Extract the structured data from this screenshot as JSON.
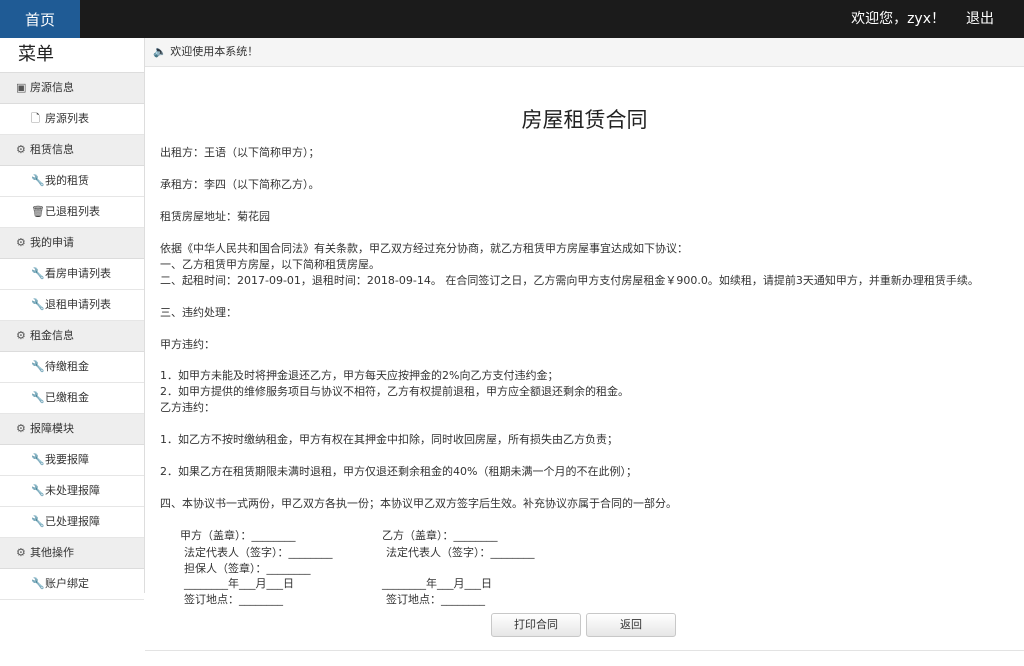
{
  "nav": {
    "home": "首页",
    "welcome": "欢迎您，zyx！",
    "logout": "退出"
  },
  "sidebar": {
    "title": "菜单",
    "groups": [
      {
        "label": "房源信息",
        "icon": "plus-square-icon",
        "items": [
          {
            "label": "房源列表",
            "icon": "file-icon"
          }
        ]
      },
      {
        "label": "租赁信息",
        "icon": "gear-icon",
        "items": [
          {
            "label": "我的租赁",
            "icon": "wrench-icon"
          },
          {
            "label": "已退租列表",
            "icon": "trash-icon"
          }
        ]
      },
      {
        "label": "我的申请",
        "icon": "gear-icon",
        "items": [
          {
            "label": "看房申请列表",
            "icon": "wrench-icon"
          },
          {
            "label": "退租申请列表",
            "icon": "wrench-icon"
          }
        ]
      },
      {
        "label": "租金信息",
        "icon": "gear-icon",
        "items": [
          {
            "label": "待缴租金",
            "icon": "wrench-icon"
          },
          {
            "label": "已缴租金",
            "icon": "wrench-icon"
          }
        ]
      },
      {
        "label": "报障模块",
        "icon": "gear-icon",
        "items": [
          {
            "label": "我要报障",
            "icon": "wrench-icon"
          },
          {
            "label": "未处理报障",
            "icon": "wrench-icon"
          },
          {
            "label": "已处理报障",
            "icon": "wrench-icon"
          }
        ]
      },
      {
        "label": "其他操作",
        "icon": "gear-icon",
        "items": [
          {
            "label": "账户绑定",
            "icon": "wrench-icon"
          }
        ]
      }
    ]
  },
  "notice": {
    "icon": "speaker-icon",
    "text": "欢迎使用本系统！"
  },
  "contract": {
    "title": "房屋租赁合同",
    "lessor": "出租方：王语（以下简称甲方）；",
    "lessee": "承租方：李四（以下简称乙方）。",
    "address": "租赁房屋地址：菊花园",
    "basis": "依据《中华人民共和国合同法》有关条款，甲乙双方经过充分协商，就乙方租赁甲方房屋事宜达成如下协议：",
    "clause1": "一、乙方租赁甲方房屋，以下简称租赁房屋。",
    "clause2": "二、起租时间：2017-09-01，退租时间：2018-09-14。 在合同签订之日，乙方需向甲方支付房屋租金￥900.0。如续租，请提前3天通知甲方，并重新办理租赁手续。",
    "clause3": "三、违约处理：",
    "partyA_breach": "甲方违约：",
    "a1": "1．如甲方未能及时将押金退还乙方，甲方每天应按押金的2%向乙方支付违约金；",
    "a2": "2．如甲方提供的维修服务项目与协议不相符，乙方有权提前退租，甲方应全额退还剩余的租金。",
    "partyB_breach": "乙方违约：",
    "b1": "1．如乙方不按时缴纳租金，甲方有权在其押金中扣除，同时收回房屋，所有损失由乙方负责；",
    "b2": "2．如果乙方在租赁期限未满时退租，甲方仅退还剩余租金的40%（租期未满一个月的不在此例）；",
    "clause4": "四、本协议书一式两份，甲乙双方各执一份；本协议甲乙双方签字后生效。补充协议亦属于合同的一部分。"
  },
  "signatures": {
    "left": {
      "party": "甲方（盖章）：________",
      "rep": "法定代表人（签字）：________",
      "guarantor": "担保人（签章）：________",
      "date": "________年___月___日",
      "place": "签订地点：________"
    },
    "right": {
      "party": "乙方（盖章）：________",
      "rep": "法定代表人（签字）：________",
      "date": "________年___月___日",
      "place": "签订地点：________"
    }
  },
  "buttons": {
    "print": "打印合同",
    "back": "返回"
  }
}
